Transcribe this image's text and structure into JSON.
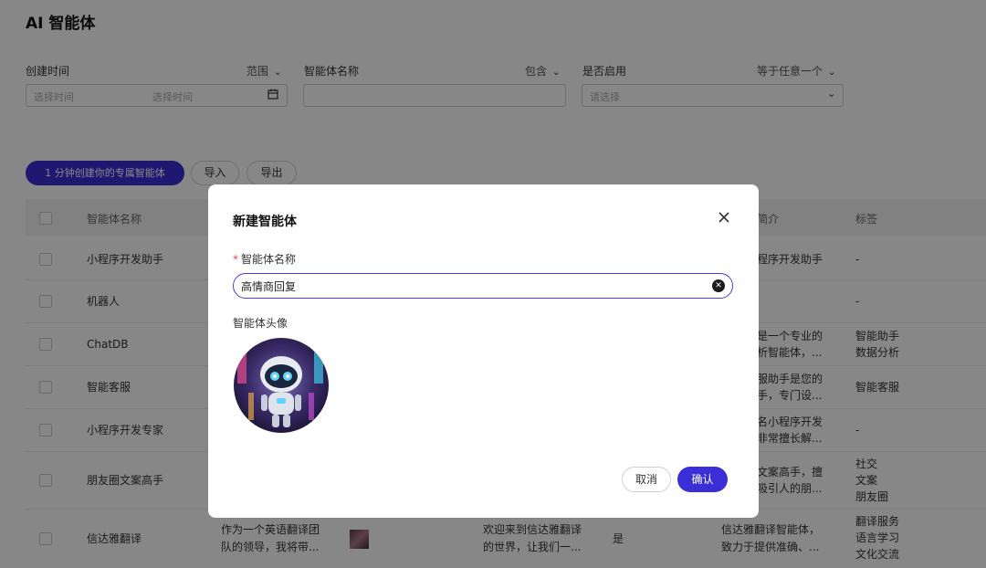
{
  "page": {
    "title": "AI 智能体"
  },
  "filters": {
    "created": {
      "label": "创建时间",
      "op": "范围",
      "start_placeholder": "选择时间",
      "end_placeholder": "选择时间"
    },
    "name": {
      "label": "智能体名称",
      "op": "包含"
    },
    "enabled": {
      "label": "是否启用",
      "op": "等于任意一个",
      "placeholder": "请选择"
    }
  },
  "toolbar": {
    "create_label": "1 分钟创建你的专属智能体",
    "import_label": "导入",
    "export_label": "导出"
  },
  "table": {
    "headers": {
      "name": "智能体名称",
      "intro": "简介",
      "tags": "标签"
    },
    "rows": [
      {
        "name": "小程序开发助手",
        "col3": "",
        "col4": "",
        "col5": "",
        "intro1": "程序开发助手",
        "intro2": "",
        "tags": [
          "-"
        ]
      },
      {
        "name": "机器人",
        "col3": "",
        "col4": "",
        "col5": "",
        "intro1": "",
        "intro2": "",
        "tags": [
          "-"
        ]
      },
      {
        "name": "ChatDB",
        "col3": "",
        "col4": "",
        "col5": "",
        "intro1": "是一个专业的",
        "intro2": "析智能体，...",
        "tags": [
          "智能助手",
          "数据分析"
        ]
      },
      {
        "name": "智能客服",
        "col3": "",
        "col4": "",
        "col5": "",
        "intro1": "服助手是您的",
        "intro2": "手，专门设...",
        "tags": [
          "智能客服"
        ]
      },
      {
        "name": "小程序开发专家",
        "col3": "",
        "col4": "",
        "col5": "",
        "intro1": "名小程序开发",
        "intro2": "非常擅长解...",
        "tags": [
          "-"
        ]
      },
      {
        "name": "朋友圈文案高手",
        "col3": "",
        "col4": "",
        "col5": "",
        "intro1": "文案高手，擅",
        "intro2": "吸引人的朋...",
        "tags": [
          "社交",
          "文案",
          "朋友圈"
        ]
      },
      {
        "name": "信达雅翻译",
        "prompt1": "作为一个英语翻译团",
        "prompt2": "队的领导，我将带...",
        "welcome1": "欢迎来到信达雅翻译",
        "welcome2": "的世界，让我们一...",
        "enabled": "是",
        "intro1": "信达雅翻译智能体，",
        "intro2": "致力于提供准确、...",
        "tags": [
          "翻译服务",
          "语言学习",
          "文化交流"
        ]
      }
    ]
  },
  "modal": {
    "title": "新建智能体",
    "name_label": "智能体名称",
    "name_value": "高情商回复",
    "avatar_label": "智能体头像",
    "cancel_label": "取消",
    "confirm_label": "确认"
  },
  "colors": {
    "accent": "#3a2fd6",
    "required": "#e5484d"
  }
}
